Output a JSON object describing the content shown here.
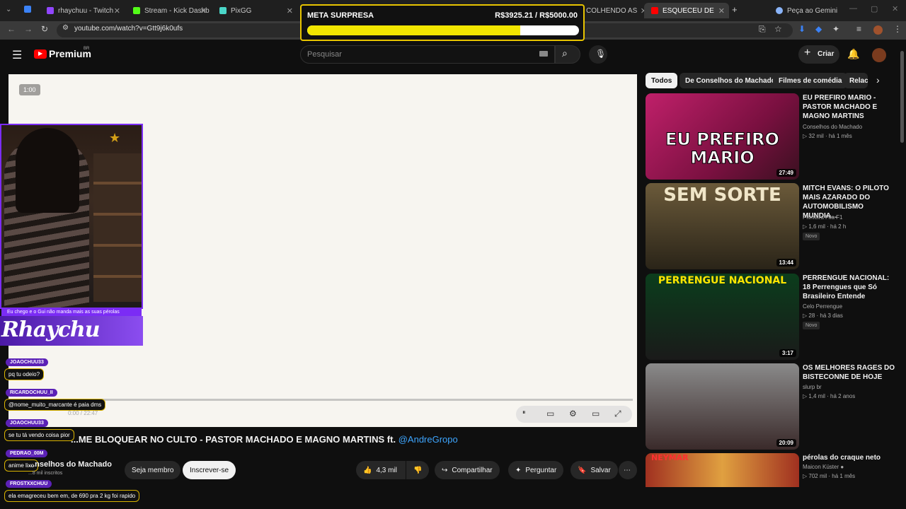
{
  "browser": {
    "tabs": [
      {
        "label": "rhaychuu - Twitch",
        "favicon_color": "#9146ff"
      },
      {
        "label": "Stream - Kick Dashb",
        "favicon_color": "#53fc18"
      },
      {
        "label": "PixGG",
        "favicon_color": "#4ad6c8"
      },
      {
        "label": "COLHENDO AS",
        "favicon_color": "#ff0000"
      },
      {
        "label": "ESQUECEU DE ME BL",
        "favicon_color": "#ff0000"
      },
      {
        "label": "Peça ao Gemini",
        "favicon_color": "#8ab4f8"
      }
    ],
    "url": "youtube.com/watch?v=Gtt9j6k0ufs"
  },
  "goal": {
    "label": "META SURPRESA",
    "amount_text": "R$3925.21 / R$5000.00",
    "progress_fraction": 0.785,
    "bar_color": "#f2e600",
    "border_color": "#e8c400"
  },
  "youtube": {
    "logo_text": "Premium",
    "region": "BR",
    "search_placeholder": "Pesquisar",
    "create_label": "Criar"
  },
  "player": {
    "time_badge": "1:00",
    "time_readout": "0:00 / 22:47"
  },
  "webcam": {
    "overlay_message": "Eu chego e o Gui não manda mais as suas pérolas",
    "streamer_name": "Rhaychu"
  },
  "chat": [
    {
      "user": "JOAOCHUU33",
      "message": "pq tu odeio?"
    },
    {
      "user": "RICARDOCHUU_II",
      "message": "@nome_muito_marcante é paia dms"
    },
    {
      "user": "JOAOCHUU33",
      "message": "se tu tá vendo coisa pior"
    },
    {
      "user": "PEDRAO_00M",
      "message": "anime lixo"
    },
    {
      "user": "FROSTXXCHUU",
      "message": "ela emagreceu bem em, de 690 pra 2 kg foi rapido"
    }
  ],
  "video": {
    "title": "...ME BLOQUEAR NO CULTO - PASTOR MACHADO E MAGNO MARTINS ft.",
    "mention": "@AndreGropo",
    "channel": "...nselhos do Machado",
    "subscribers": "...8 mil inscritos",
    "member_label": "Seja membro",
    "subscribe_label": "Inscrever-se",
    "likes": "4,3 mil",
    "share_label": "Compartilhar",
    "ask_label": "Perguntar",
    "save_label": "Salvar"
  },
  "sidebar": {
    "chips": [
      "Todos",
      "De Conselhos do Machado",
      "Filmes de comédia",
      "Relac"
    ],
    "videos": [
      {
        "title": "EU PREFIRO MARIO - PASTOR MACHADO E MAGNO MARTINS",
        "channel": "Conselhos do Machado",
        "stats": "32 mil · há 1 mês",
        "duration": "27:49",
        "new": "",
        "thumb_text": "EU PREFIRO MARIO"
      },
      {
        "title": "MITCH EVANS: O PILOTO MAIS AZARADO DO AUTOMOBILISMO MUNDIA...",
        "channel": "Primeira Fila F1",
        "stats": "1,6 mil · há 2 h",
        "duration": "13:44",
        "new": "Novo",
        "thumb_text": "SEM SORTE"
      },
      {
        "title": "PERRENGUE NACIONAL: 18 Perrengues que Só Brasileiro Entende",
        "channel": "Celo Perrengue",
        "stats": "28 · há 3 dias",
        "duration": "3:17",
        "new": "Novo",
        "thumb_text": "PERRENGUE NACIONAL"
      },
      {
        "title": "OS MELHORES RAGES DO BISTECONNE DE HOJE",
        "channel": "slurp br",
        "stats": "1,4 mil · há 2 anos",
        "duration": "20:09",
        "new": "",
        "thumb_text": ""
      },
      {
        "title": "pérolas do craque neto",
        "channel": "Maicon Küster",
        "stats": "702 mil · há 1 mês",
        "duration": "",
        "new": "",
        "thumb_text": "NEYMAR"
      }
    ]
  }
}
